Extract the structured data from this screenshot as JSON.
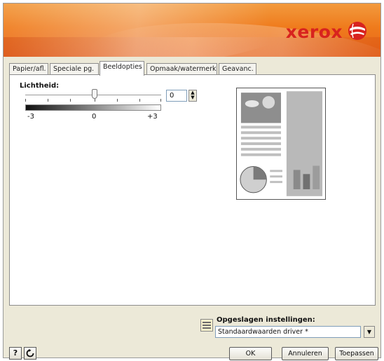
{
  "brand": {
    "logo_text": "xerox",
    "logo_color": "#d8231e",
    "banner_color": "#ef7b1c"
  },
  "tabs": [
    {
      "label": "Papier/afl.",
      "active": false
    },
    {
      "label": "Speciale pg.",
      "active": false
    },
    {
      "label": "Beeldopties",
      "active": true
    },
    {
      "label": "Opmaak/watermerk",
      "active": false
    },
    {
      "label": "Geavanc.",
      "active": false
    }
  ],
  "brightness": {
    "label": "Lichtheid:",
    "value": "0",
    "min_label": "-3",
    "mid_label": "0",
    "max_label": "+3",
    "spin_icon": "spin-up-down-icon"
  },
  "saved_settings": {
    "label": "Opgeslagen instellingen:",
    "value": "Standaardwaarden driver *",
    "icon": "saved-settings-icon"
  },
  "footer": {
    "help_label": "?",
    "reset_icon": "reset-icon",
    "ok_label": "OK",
    "cancel_label": "Annuleren",
    "apply_label": "Toepassen"
  }
}
